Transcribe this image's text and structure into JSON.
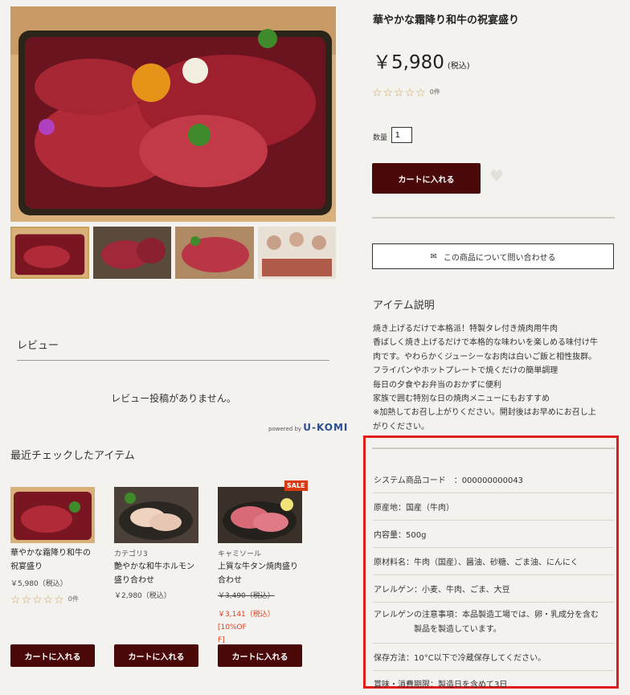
{
  "product": {
    "title": "華やかな霜降り和牛の祝宴盛り",
    "price": "￥5,980",
    "tax": "(税込)",
    "stars": "☆☆☆☆☆",
    "review_count": "0件",
    "qty_label": "数量",
    "qty_value": "1",
    "cart_label": "カートに入れる",
    "contact_label": "この商品について問い合わせる"
  },
  "description": {
    "heading": "アイテム説明",
    "lines": [
      "焼き上げるだけで本格派！特製タレ付き焼肉用牛肉",
      "香ばしく焼き上げるだけで本格的な味わいを楽しめる味付け牛",
      "肉です。やわらかくジューシーなお肉は白いご飯と相性抜群。",
      "フライパンやホットプレートで焼くだけの簡単調理",
      "毎日の夕食やお弁当のおかずに便利",
      "家族で囲む特別な日の焼肉メニューにもおすすめ",
      "※加熱してお召し上がりください。開封後はお早めにお召し上",
      "がりください。"
    ]
  },
  "specs": [
    "システム商品コード　：000000000043",
    "原産地：国産（牛肉）",
    "内容量：500g",
    "原材料名：牛肉（国産）、醤油、砂糖、ごま油、にんにく",
    "アレルゲン：小麦、牛肉、ごま、大豆",
    "アレルゲンの注意事項：本品製造工場では、卵・乳成分を含む",
    "製品を製造しています。",
    "保存方法：10°C以下で冷蔵保存してください。",
    "賞味・消費期限：製造日を含めて3日"
  ],
  "review": {
    "heading": "レビュー",
    "empty": "レビュー投稿がありません。",
    "powered": "powered by",
    "brand": "U-KOMI"
  },
  "recent": {
    "heading": "最近チェックしたアイテム",
    "items": [
      {
        "category": "",
        "name1": "華やかな霜降り和牛の",
        "name2": "祝宴盛り",
        "price": "￥5,980（税込）",
        "stars": "☆☆☆☆☆",
        "count": "0件",
        "cart": "カートに入れる"
      },
      {
        "category": "カテゴリ3",
        "name1": "艶やかな和牛ホルモン",
        "name2": "盛り合わせ",
        "price": "￥2,980（税込）",
        "cart": "カートに入れる"
      },
      {
        "category": "キャミソール",
        "name1": "上質な牛タン焼肉盛り",
        "name2": "合わせ",
        "old_price": "￥3,490（税込）",
        "sale_price1": "￥3,141（税込） [10%OF",
        "sale_price2": "F]",
        "badge": "SALE",
        "cart": "カートに入れる"
      }
    ]
  },
  "colors": {
    "accent": "#4a0808",
    "sale": "#d93a12",
    "highlight": "#e01c1c",
    "background": "#f4f2ee"
  }
}
